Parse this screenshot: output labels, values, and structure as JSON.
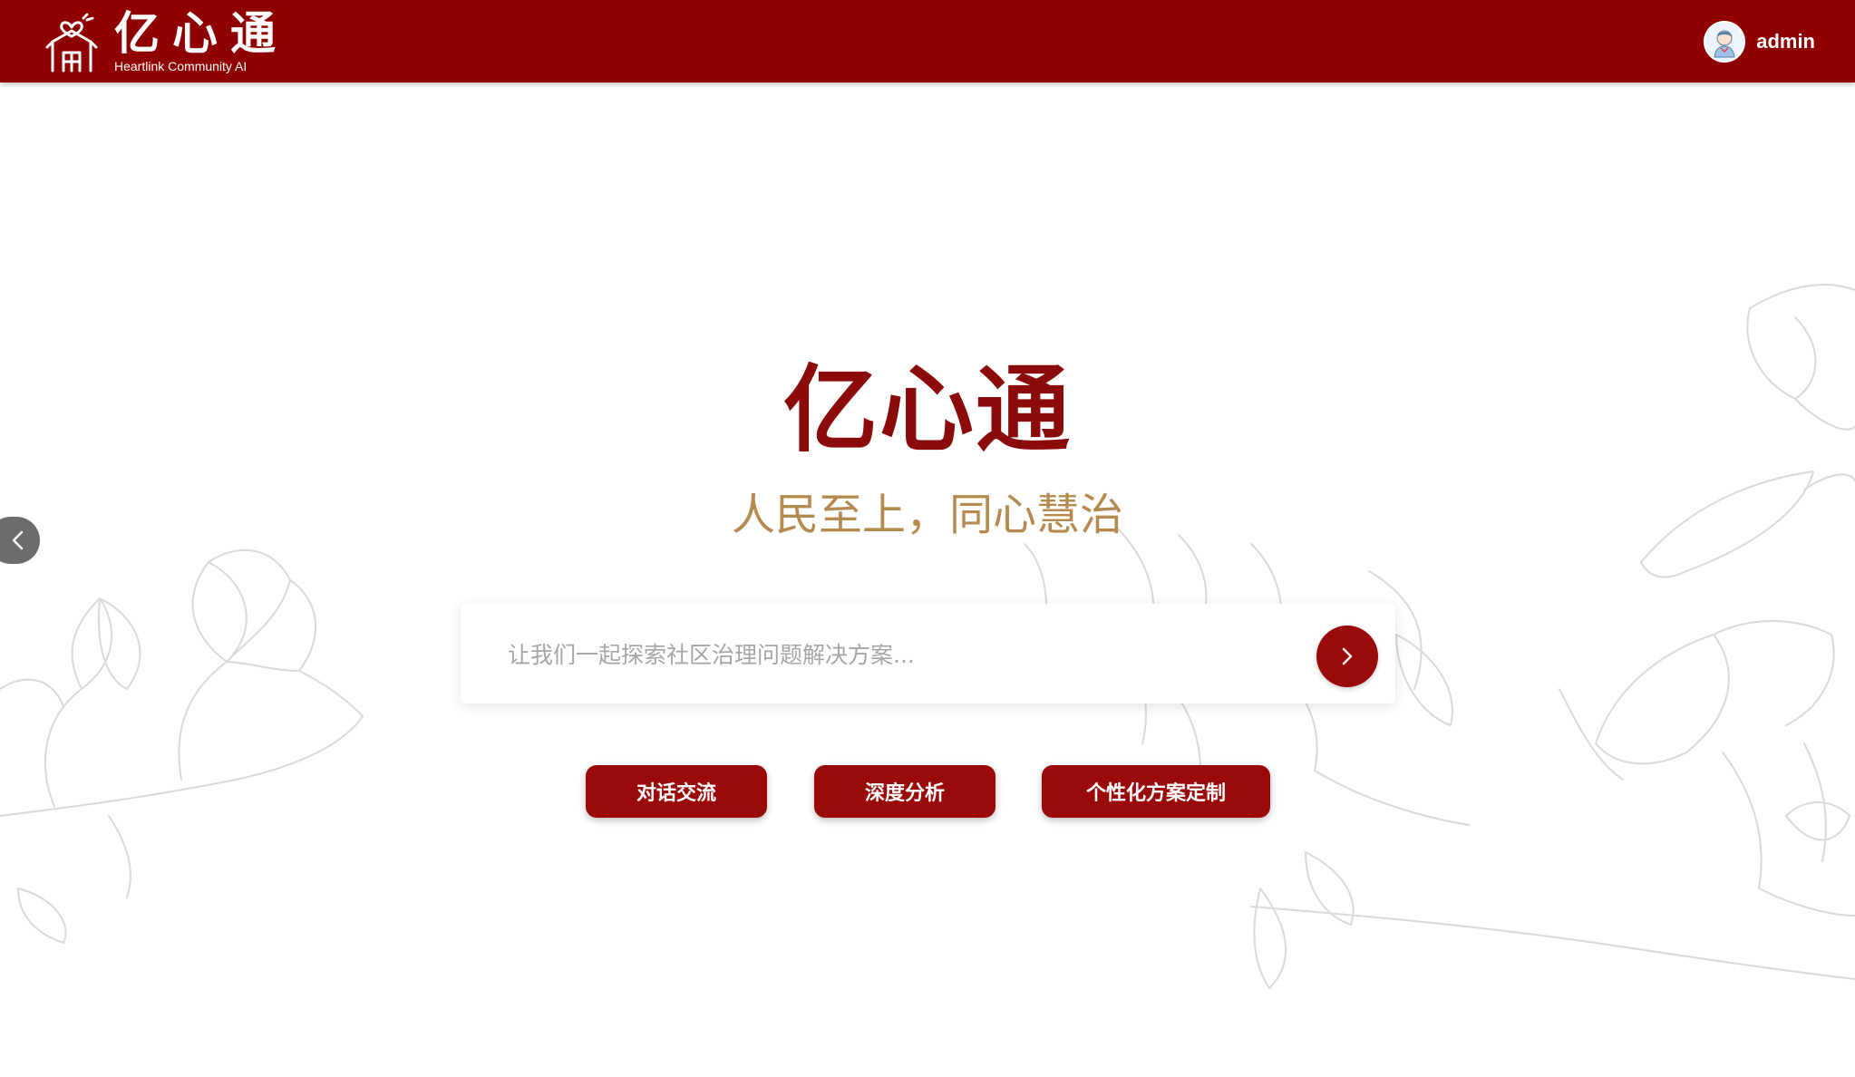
{
  "header": {
    "brand_name": "亿心通",
    "brand_subtitle": "Heartlink Community AI",
    "username": "admin"
  },
  "hero": {
    "title": "亿心通",
    "slogan": "人民至上，同心慧治"
  },
  "search": {
    "placeholder": "让我们一起探索社区治理问题解决方案...",
    "value": ""
  },
  "actions": [
    {
      "label": "对话交流"
    },
    {
      "label": "深度分析"
    },
    {
      "label": "个性化方案定制"
    }
  ],
  "colors": {
    "primary": "#8f0000",
    "button": "#9b0a0a",
    "title": "#8b0a0a",
    "slogan": "#b58a4f",
    "placeholder": "#a6a6a6"
  },
  "icons": {
    "logo": "building-heart-logo-icon",
    "avatar": "user-avatar-icon",
    "send": "chevron-right-icon",
    "collapse": "chevron-left-icon"
  }
}
